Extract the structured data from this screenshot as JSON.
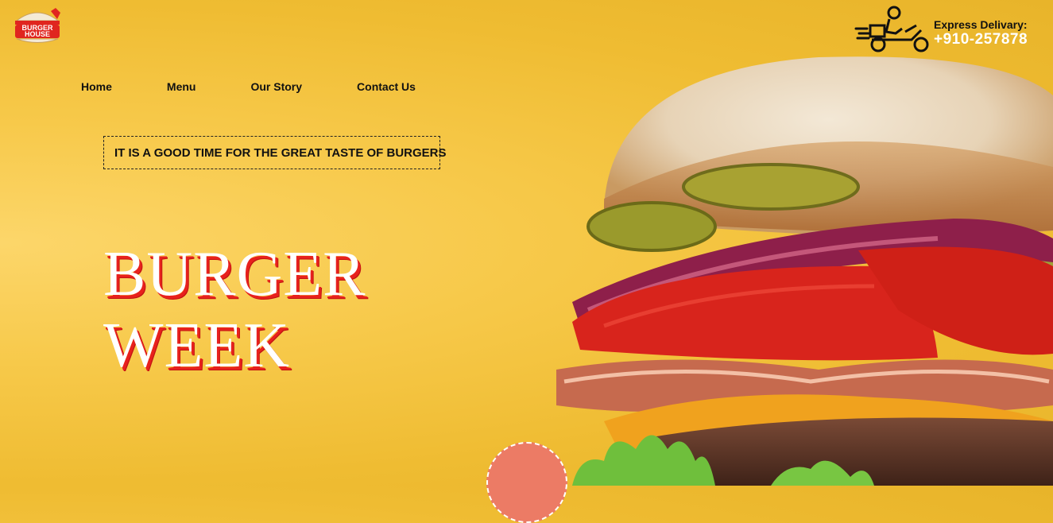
{
  "brand": {
    "logo_lines": [
      "BURGER",
      "HOUSE"
    ]
  },
  "delivery": {
    "label": "Express Delivary:",
    "phone": "+910-257878",
    "icon": "delivery-scooter-icon"
  },
  "nav": {
    "items": [
      {
        "label": "Home"
      },
      {
        "label": "Menu"
      },
      {
        "label": "Our Story"
      },
      {
        "label": "Contact Us"
      }
    ]
  },
  "hero": {
    "tagline": "IT IS A GOOD TIME FOR THE GREAT TASTE OF BURGERS",
    "title_lines": [
      "BURGER",
      "WEEK"
    ]
  },
  "colors": {
    "background": "#f5c53f",
    "accent_red": "#e8211d",
    "badge": "#ec7b65"
  }
}
